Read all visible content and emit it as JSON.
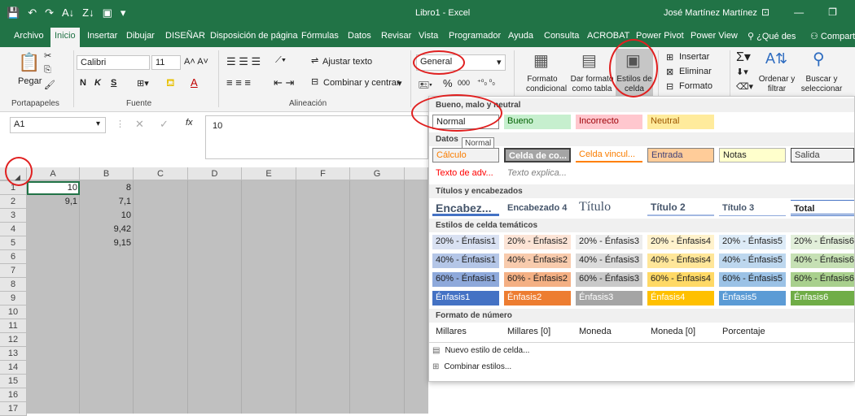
{
  "titlebar": {
    "title": "Libro1 - Excel",
    "user": "José Martínez Martínez",
    "qat": [
      "💾",
      "↶",
      "↷",
      "A↓",
      "Z↓",
      "▣",
      "▾"
    ],
    "controls": [
      "⊡",
      "—",
      "❐"
    ]
  },
  "tabs": [
    "Archivo",
    "Inicio",
    "Insertar",
    "Dibujar",
    "DISEÑAR",
    "Disposición de página",
    "Fórmulas",
    "Datos",
    "Revisar",
    "Vista",
    "Programador",
    "Ayuda",
    "Consulta",
    "ACROBAT",
    "Power Pivot",
    "Power View",
    "¿Qué des",
    "Compart"
  ],
  "ribbon": {
    "clipboard": {
      "paste": "Pegar",
      "label": "Portapapeles"
    },
    "font": {
      "name": "Calibri",
      "size": "11",
      "bold": "N",
      "italic": "K",
      "underline": "S",
      "label": "Fuente"
    },
    "align": {
      "wrap": "Ajustar texto",
      "merge": "Combinar y centrar",
      "label": "Alineación"
    },
    "number": {
      "format": "General",
      "percent": "%",
      "thousands": "000"
    },
    "styles": {
      "cond": "Formato condicional",
      "table": "Dar formato como tabla",
      "cell": "Estilos de celda"
    },
    "cells": {
      "insert": "Insertar",
      "delete": "Eliminar",
      "format": "Formato"
    },
    "editing": {
      "sort": "Ordenar y filtrar",
      "find": "Buscar y seleccionar"
    }
  },
  "formula": {
    "namebox": "A1",
    "fx": "fx",
    "value": "10"
  },
  "columns": [
    "A",
    "B",
    "C",
    "D",
    "E",
    "F",
    "G"
  ],
  "rows": [
    "1",
    "2",
    "3",
    "4",
    "5",
    "6",
    "7",
    "8",
    "9",
    "10",
    "11",
    "12",
    "13",
    "14",
    "15",
    "16",
    "17"
  ],
  "cells": {
    "a1": "10",
    "b1": "8",
    "a2": "9,1",
    "b2": "7,1",
    "b3": "10",
    "b4": "9,42",
    "b5": "9,15"
  },
  "panel": {
    "sec1": "Bueno, malo y neutral",
    "good": [
      "Normal",
      "Bueno",
      "Incorrecto",
      "Neutral"
    ],
    "tooltip": "Normal",
    "sec2": "Datos",
    "data1": [
      "Cálculo",
      "Celda de co...",
      "Celda vincul...",
      "Entrada",
      "Notas",
      "Salida"
    ],
    "data2": [
      "Texto de adv...",
      "Texto explica..."
    ],
    "sec3": "Títulos y encabezados",
    "titles": [
      "Encabez...",
      "Encabezado 4",
      "Título",
      "Título 2",
      "Título 3",
      "Total"
    ],
    "sec4": "Estilos de celda temáticos",
    "t20": [
      "20% - Énfasis1",
      "20% - Énfasis2",
      "20% - Énfasis3",
      "20% - Énfasis4",
      "20% - Énfasis5",
      "20% - Énfasis6"
    ],
    "t40": [
      "40% - Énfasis1",
      "40% - Énfasis2",
      "40% - Énfasis3",
      "40% - Énfasis4",
      "40% - Énfasis5",
      "40% - Énfasis6"
    ],
    "t60": [
      "60% - Énfasis1",
      "60% - Énfasis2",
      "60% - Énfasis3",
      "60% - Énfasis4",
      "60% - Énfasis5",
      "60% - Énfasis6"
    ],
    "t100": [
      "Énfasis1",
      "Énfasis2",
      "Énfasis3",
      "Énfasis4",
      "Énfasis5",
      "Énfasis6"
    ],
    "sec5": "Formato de número",
    "num": [
      "Millares",
      "Millares [0]",
      "Moneda",
      "Moneda [0]",
      "Porcentaje"
    ],
    "new": "Nuevo estilo de celda...",
    "merge": "Combinar estilos..."
  },
  "colors": {
    "accent1": "#4472c4",
    "accent2": "#ed7d31",
    "accent3": "#a5a5a5",
    "accent4": "#ffc000",
    "accent5": "#5b9bd5",
    "accent6": "#70ad47"
  }
}
